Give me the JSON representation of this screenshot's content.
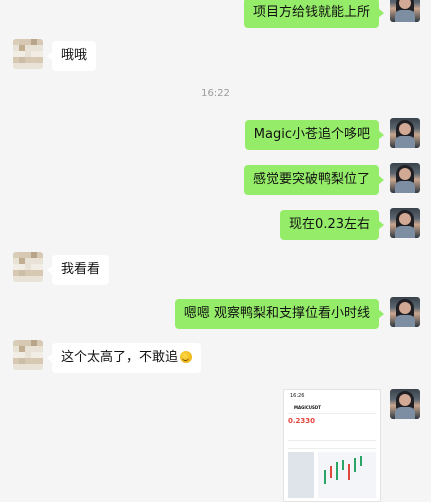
{
  "messages": [
    {
      "side": "me",
      "text": "项目方给钱就能上所"
    },
    {
      "side": "them",
      "text": "哦哦"
    },
    {
      "timestamp": "16:22"
    },
    {
      "side": "me",
      "text": "Magic小苍追个哆吧"
    },
    {
      "side": "me",
      "text": "感觉要突破鸭梨位了"
    },
    {
      "side": "me",
      "text": "现在0.23左右"
    },
    {
      "side": "them",
      "text": "我看看"
    },
    {
      "side": "me",
      "text": "嗯嗯 观察鸭梨和支撑位看小时线"
    },
    {
      "side": "them",
      "text": "这个太高了，不敢追"
    }
  ],
  "screenshot": {
    "time": "16:26",
    "pair": "MAGICUSDT",
    "price": "0.2330"
  },
  "icons": {
    "emoji": "grinning-sweat-emoji"
  }
}
